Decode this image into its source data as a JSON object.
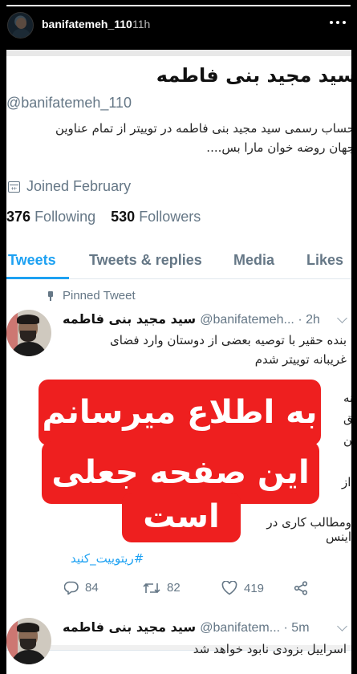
{
  "story": {
    "username": "banifatemeh_110",
    "time": "11h",
    "progress_fraction": 1.0
  },
  "profile": {
    "name": "سید مجید بنی فاطمه",
    "handle": "@banifatemeh_110",
    "bio_line1": "حساب رسمی سید مجید بنی فاطمه در توییتر  از تمام عناوین",
    "bio_line2": "جهان روضه خوان مارا بس....",
    "joined": "Joined February",
    "following_count": "376",
    "following_label": "Following",
    "followers_count": "530",
    "followers_label": "Followers"
  },
  "tabs": [
    {
      "label": "Tweets",
      "active": true
    },
    {
      "label": "Tweets & replies",
      "active": false
    },
    {
      "label": "Media",
      "active": false
    },
    {
      "label": "Likes",
      "active": false
    }
  ],
  "pinned_label": "Pinned Tweet",
  "tweet1": {
    "name": "سید مجید بنی فاطمه",
    "handle_time": "@banifatemeh... · 2h",
    "line1": "بنده حقیر با توصیه بعضی از دوستان وارد فضای",
    "line2": "غریبانه توییتر شدم",
    "partial1": "ینه",
    "partial2": "انق",
    "partial3": "تن",
    "partial4": "از",
    "partial5": "ومطالب کاری در اینس",
    "hashtag": "#ریتوییت_کنید",
    "replies": "84",
    "retweets": "82",
    "likes": "419"
  },
  "tweet2": {
    "name": "سید مجید بنی فاطمه",
    "handle_time": "@banifatem... · 5m",
    "line1": "اسراییل بزودی نابود خواهد شد"
  },
  "sticker": {
    "line1": "به اطلاع میرسانم",
    "line2": "این صفحه جعلی",
    "line3": "است",
    "color": "#ee1f1f"
  },
  "colors": {
    "accent": "#1da1f2",
    "muted": "#657786"
  }
}
